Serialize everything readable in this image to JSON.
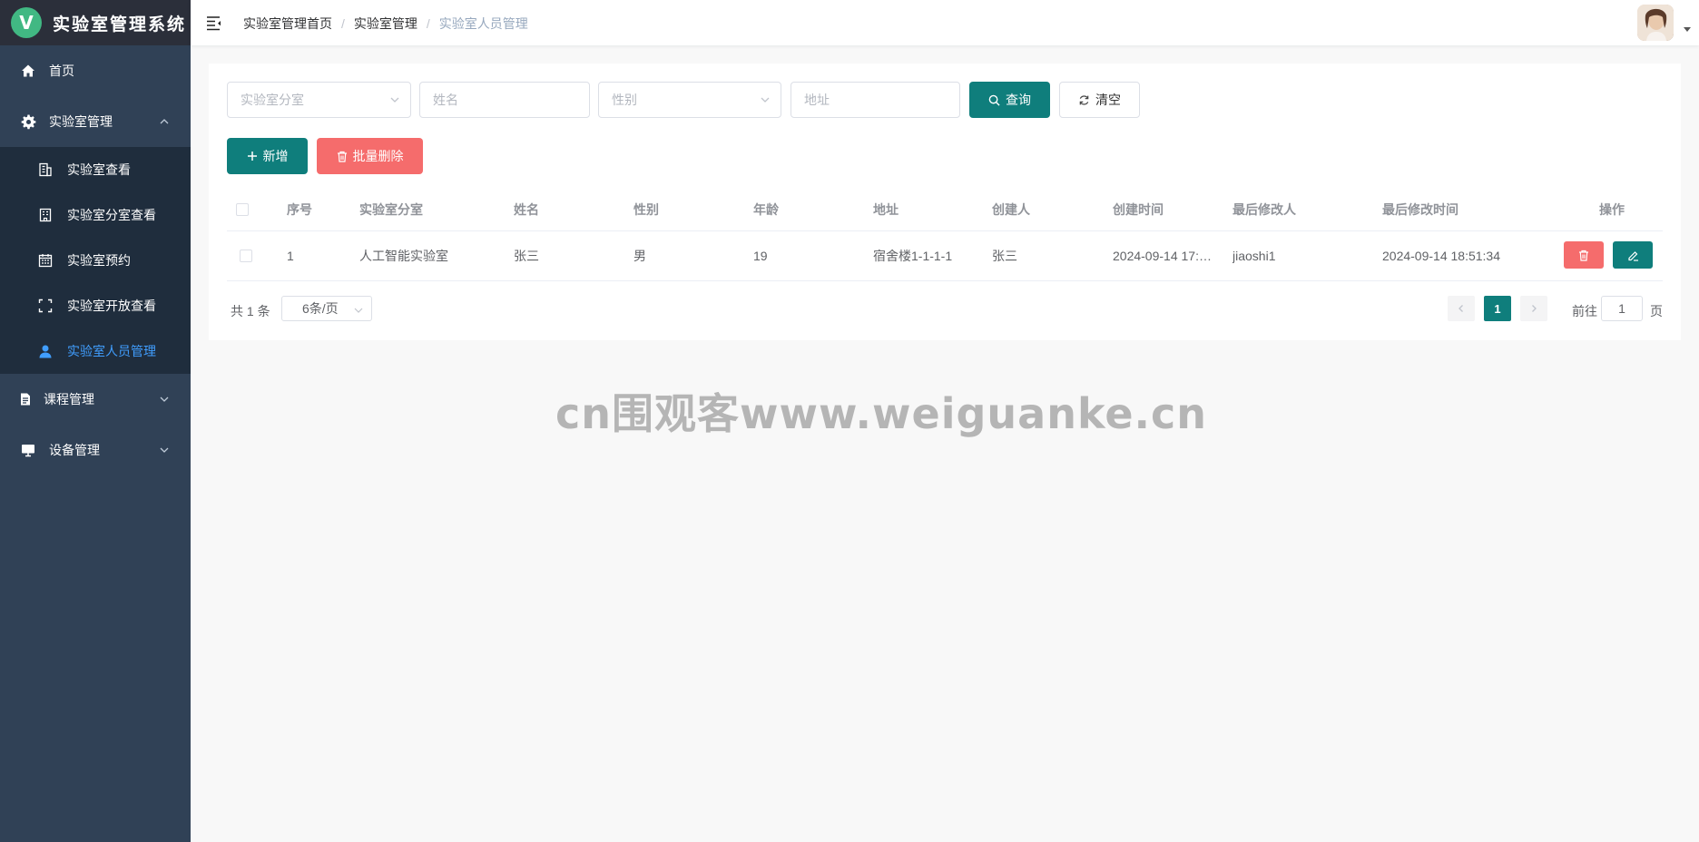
{
  "app": {
    "logo_letter": "V",
    "title": "实验室管理系统"
  },
  "sidebar": {
    "items": [
      {
        "label": "首页",
        "icon": "home-icon"
      },
      {
        "label": "实验室管理",
        "icon": "gear-icon",
        "expanded": true
      },
      {
        "label": "课程管理",
        "icon": "document-icon",
        "expanded": false
      },
      {
        "label": "设备管理",
        "icon": "monitor-icon",
        "expanded": false
      }
    ],
    "sub_items": [
      {
        "label": "实验室查看",
        "icon": "building-icon"
      },
      {
        "label": "实验室分室查看",
        "icon": "office-icon"
      },
      {
        "label": "实验室预约",
        "icon": "calendar-icon"
      },
      {
        "label": "实验室开放查看",
        "icon": "fullscreen-icon"
      },
      {
        "label": "实验室人员管理",
        "icon": "user-icon",
        "active": true
      }
    ]
  },
  "breadcrumb": [
    "实验室管理首页",
    "实验室管理",
    "实验室人员管理"
  ],
  "filters": {
    "room_placeholder": "实验室分室",
    "name_placeholder": "姓名",
    "gender_placeholder": "性别",
    "address_placeholder": "地址",
    "search_label": "查询",
    "clear_label": "清空"
  },
  "actions": {
    "add_label": "新增",
    "batch_delete_label": "批量删除"
  },
  "table": {
    "headers": [
      "序号",
      "实验室分室",
      "姓名",
      "性别",
      "年龄",
      "地址",
      "创建人",
      "创建时间",
      "最后修改人",
      "最后修改时间",
      "操作"
    ],
    "rows": [
      {
        "index": "1",
        "room": "人工智能实验室",
        "name": "张三",
        "gender": "男",
        "age": "19",
        "address": "宿舍楼1-1-1-1",
        "creator": "张三",
        "created_at": "2024-09-14 17:…",
        "modifier": "jiaoshi1",
        "modified_at": "2024-09-14 18:51:34"
      }
    ]
  },
  "pagination": {
    "total_text": "共 1 条",
    "page_size": "6条/页",
    "current_page": "1",
    "goto_prefix": "前往",
    "goto_value": "1",
    "goto_suffix": "页"
  },
  "watermark": "cn围观客www.weiguanke.cn",
  "colors": {
    "sidebar": "#304156",
    "logo_bar": "#2b2f3a",
    "submenu": "#1f2d3d",
    "accent": "#0f7e7c",
    "active_link": "#409eff",
    "danger": "#f56c6c"
  }
}
